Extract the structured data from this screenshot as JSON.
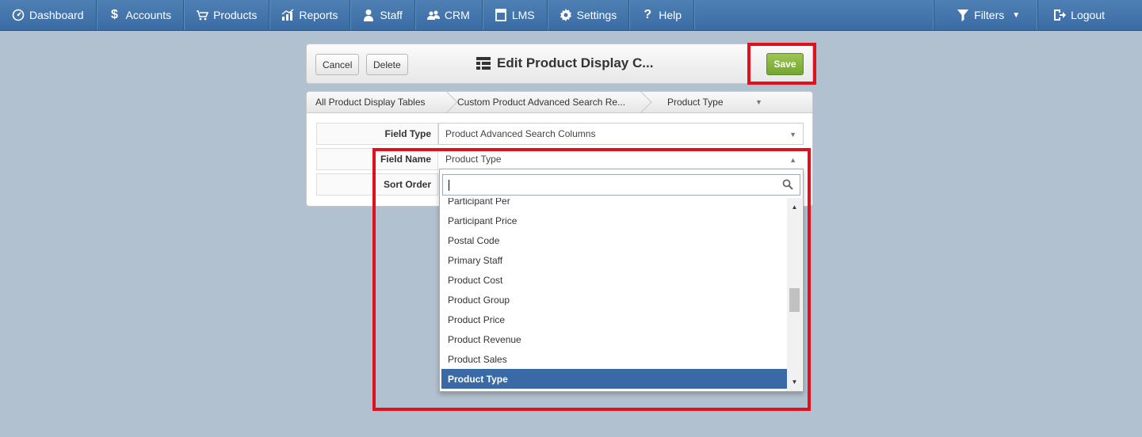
{
  "nav": {
    "left": [
      {
        "label": "Dashboard",
        "icon": "dashboard-icon"
      },
      {
        "label": "Accounts",
        "icon": "dollar-icon"
      },
      {
        "label": "Products",
        "icon": "cart-icon"
      },
      {
        "label": "Reports",
        "icon": "chart-icon"
      },
      {
        "label": "Staff",
        "icon": "person-icon"
      },
      {
        "label": "CRM",
        "icon": "people-icon"
      },
      {
        "label": "LMS",
        "icon": "book-icon"
      },
      {
        "label": "Settings",
        "icon": "gear-icon"
      },
      {
        "label": "Help",
        "icon": "question-icon"
      }
    ],
    "right": [
      {
        "label": "Filters",
        "icon": "filter-icon",
        "caret": "▼"
      },
      {
        "label": "Logout",
        "icon": "logout-icon"
      }
    ]
  },
  "header": {
    "cancel_label": "Cancel",
    "delete_label": "Delete",
    "title": "Edit Product Display C...",
    "save_label": "Save"
  },
  "breadcrumb": {
    "items": [
      "All Product Display Tables",
      "Custom Product Advanced Search Re...",
      "Product Type"
    ],
    "caret": "▼"
  },
  "form": {
    "rows": [
      {
        "label": "Field Type",
        "value": "Product Advanced Search Columns",
        "arrow": "▼"
      },
      {
        "label": "Field Name",
        "value": "Product Type",
        "arrow": "▲"
      },
      {
        "label": "Sort Order",
        "value": ""
      }
    ]
  },
  "dropdown": {
    "search_value": "",
    "options": [
      "Participant Per",
      "Participant Price",
      "Postal Code",
      "Primary Staff",
      "Product Cost",
      "Product Group",
      "Product Price",
      "Product Revenue",
      "Product Sales",
      "Product Type"
    ],
    "selected": "Product Type",
    "scroll_up": "▲",
    "scroll_down": "▼"
  },
  "colors": {
    "nav_bg": "#3f70a8",
    "highlight": "#e0101d",
    "save_green": "#85b13e",
    "selected_bg": "#3a6aa5",
    "page_bg": "#b2c1d0"
  }
}
